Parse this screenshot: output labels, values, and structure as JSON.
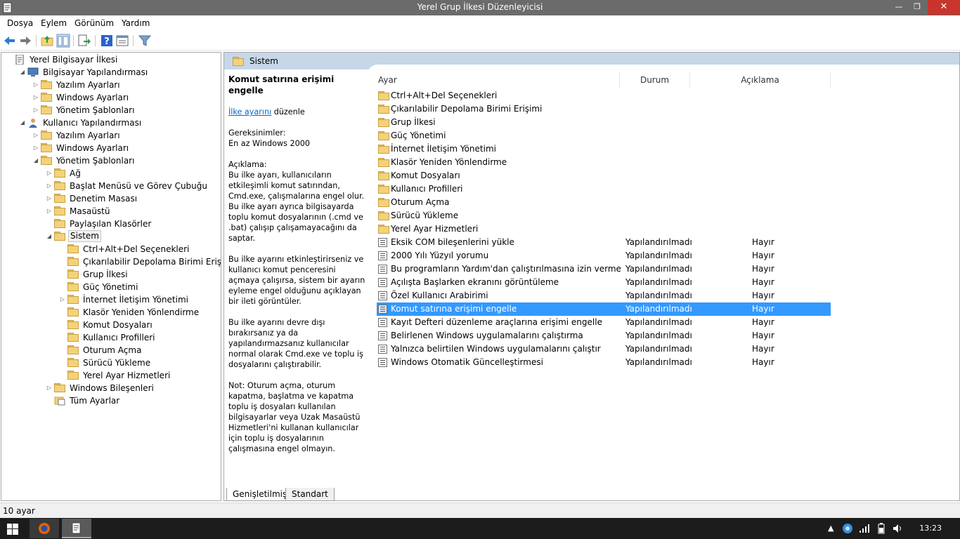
{
  "window": {
    "title": "Yerel Grup İlkesi Düzenleyicisi",
    "min": "—",
    "max": "❐",
    "close": "✕"
  },
  "menu": [
    "Dosya",
    "Eylem",
    "Görünüm",
    "Yardım"
  ],
  "tree": [
    {
      "label": "Yerel Bilgisayar İlkesi",
      "icon": "policy-doc-icon"
    },
    {
      "label": "Bilgisayar Yapılandırması",
      "icon": "computer-icon"
    },
    {
      "label": "Yazılım Ayarları",
      "icon": "folder-icon"
    },
    {
      "label": "Windows Ayarları",
      "icon": "folder-icon"
    },
    {
      "label": "Yönetim Şablonları",
      "icon": "folder-icon"
    },
    {
      "label": "Kullanıcı Yapılandırması",
      "icon": "user-icon"
    },
    {
      "label": "Yazılım Ayarları",
      "icon": "folder-icon"
    },
    {
      "label": "Windows Ayarları",
      "icon": "folder-icon"
    },
    {
      "label": "Yönetim Şablonları",
      "icon": "folder-icon"
    },
    {
      "label": "Ağ",
      "icon": "folder-icon"
    },
    {
      "label": "Başlat Menüsü ve Görev Çubuğu",
      "icon": "folder-icon"
    },
    {
      "label": "Denetim Masası",
      "icon": "folder-icon"
    },
    {
      "label": "Masaüstü",
      "icon": "folder-icon"
    },
    {
      "label": "Paylaşılan Klasörler",
      "icon": "folder-icon"
    },
    {
      "label": "Sistem",
      "icon": "folder-icon",
      "selected": true
    },
    {
      "label": "Ctrl+Alt+Del Seçenekleri",
      "icon": "folder-icon"
    },
    {
      "label": "Çıkarılabilir Depolama Birimi Erişimi",
      "icon": "folder-icon"
    },
    {
      "label": "Grup İlkesi",
      "icon": "folder-icon"
    },
    {
      "label": "Güç Yönetimi",
      "icon": "folder-icon"
    },
    {
      "label": "İnternet İletişim Yönetimi",
      "icon": "folder-icon"
    },
    {
      "label": "Klasör Yeniden Yönlendirme",
      "icon": "folder-icon"
    },
    {
      "label": "Komut Dosyaları",
      "icon": "folder-icon"
    },
    {
      "label": "Kullanıcı Profilleri",
      "icon": "folder-icon"
    },
    {
      "label": "Oturum Açma",
      "icon": "folder-icon"
    },
    {
      "label": "Sürücü Yükleme",
      "icon": "folder-icon"
    },
    {
      "label": "Yerel Ayar Hizmetleri",
      "icon": "folder-icon"
    },
    {
      "label": "Windows Bileşenleri",
      "icon": "folder-icon"
    },
    {
      "label": "Tüm Ayarlar",
      "icon": "all-settings-icon"
    }
  ],
  "right": {
    "header": "Sistem",
    "description": {
      "title": "Komut satırına erişimi engelle",
      "link": "İlke ayarını",
      "link_suffix": " düzenle",
      "requirements": "Gereksinimler:\nEn az Windows 2000",
      "body1": "Açıklama:\nBu ilke ayarı, kullanıcıların etkileşimli komut satırından, Cmd.exe, çalışmalarına engel olur.  Bu ilke ayarı ayrıca bilgisayarda toplu komut dosyalarının (.cmd ve .bat) çalışıp çalışamayacağını da saptar.",
      "body2": "Bu ilke ayarını etkinleştirirseniz ve kullanıcı komut penceresini açmaya çalışırsa, sistem bir ayarın eyleme engel olduğunu açıklayan bir ileti görüntüler.",
      "body3": "Bu ilke ayarını devre dışı bırakırsanız ya da yapılandırmazsanız kullanıcılar normal olarak Cmd.exe ve toplu iş dosyalarını çalıştırabilir.",
      "body4": "Not: Oturum açma, oturum kapatma, başlatma ve kapatma toplu iş dosyaları kullanılan bilgisayarlar veya Uzak Masaüstü Hizmetleri'ni kullanan kullanıcılar için toplu iş dosyalarının çalışmasına engel olmayın."
    },
    "columns": {
      "setting": "Ayar",
      "state": "Durum",
      "comment": "Açıklama"
    },
    "folders": [
      "Ctrl+Alt+Del Seçenekleri",
      "Çıkarılabilir Depolama Birimi Erişimi",
      "Grup İlkesi",
      "Güç Yönetimi",
      "İnternet İletişim Yönetimi",
      "Klasör Yeniden Yönlendirme",
      "Komut Dosyaları",
      "Kullanıcı Profilleri",
      "Oturum Açma",
      "Sürücü Yükleme",
      "Yerel Ayar Hizmetleri"
    ],
    "policies": [
      {
        "name": "Eksik COM bileşenlerini yükle",
        "state": "Yapılandırılmadı",
        "comment": "Hayır"
      },
      {
        "name": "2000 Yılı Yüzyıl yorumu",
        "state": "Yapılandırılmadı",
        "comment": "Hayır"
      },
      {
        "name": "Bu programların Yardım'dan çalıştırılmasına izin verme",
        "state": "Yapılandırılmadı",
        "comment": "Hayır"
      },
      {
        "name": "Açılışta Başlarken ekranını görüntüleme",
        "state": "Yapılandırılmadı",
        "comment": "Hayır"
      },
      {
        "name": "Özel Kullanıcı Arabirimi",
        "state": "Yapılandırılmadı",
        "comment": "Hayır"
      },
      {
        "name": "Komut satırına erişimi engelle",
        "state": "Yapılandırılmadı",
        "comment": "Hayır",
        "selected": true
      },
      {
        "name": "Kayıt Defteri düzenleme araçlarına erişimi engelle",
        "state": "Yapılandırılmadı",
        "comment": "Hayır"
      },
      {
        "name": "Belirlenen Windows uygulamalarını çalıştırma",
        "state": "Yapılandırılmadı",
        "comment": "Hayır"
      },
      {
        "name": "Yalnızca belirtilen Windows uygulamalarını çalıştır",
        "state": "Yapılandırılmadı",
        "comment": "Hayır"
      },
      {
        "name": "Windows Otomatik Güncelleştirmesi",
        "state": "Yapılandırılmadı",
        "comment": "Hayır"
      }
    ]
  },
  "tabs": [
    "Genişletilmiş",
    "Standart"
  ],
  "status": "10 ayar",
  "taskbar": {
    "clock": "13:23"
  },
  "colors": {
    "selection": "#3399ff",
    "header": "#c6d7e8",
    "titlebar": "#6b6b6b",
    "close": "#c7352c"
  }
}
